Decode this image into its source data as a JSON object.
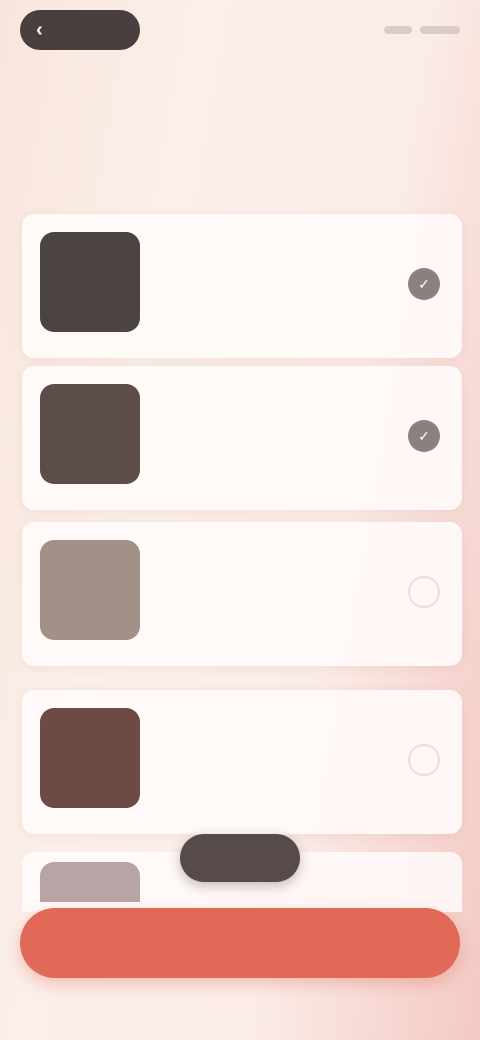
{
  "header": {
    "back_label": "",
    "subtitle": ""
  },
  "page_title": "",
  "items": [
    {
      "title": "",
      "description": "",
      "selected": true,
      "thumb_color": "#4b4441"
    },
    {
      "title": "",
      "description": "",
      "selected": true,
      "thumb_color": "#5c4d48"
    },
    {
      "title": "",
      "description": "",
      "selected": false,
      "thumb_color": "#a39086"
    },
    {
      "title": "",
      "description": "",
      "selected": false,
      "thumb_color": "#6b4b43"
    }
  ],
  "floating_action": {
    "label": ""
  },
  "primary_action": {
    "label": ""
  },
  "colors": {
    "accent": "#e06a57",
    "dark_pill": "#4a3f3f",
    "selected_toggle": "#8a807e"
  }
}
